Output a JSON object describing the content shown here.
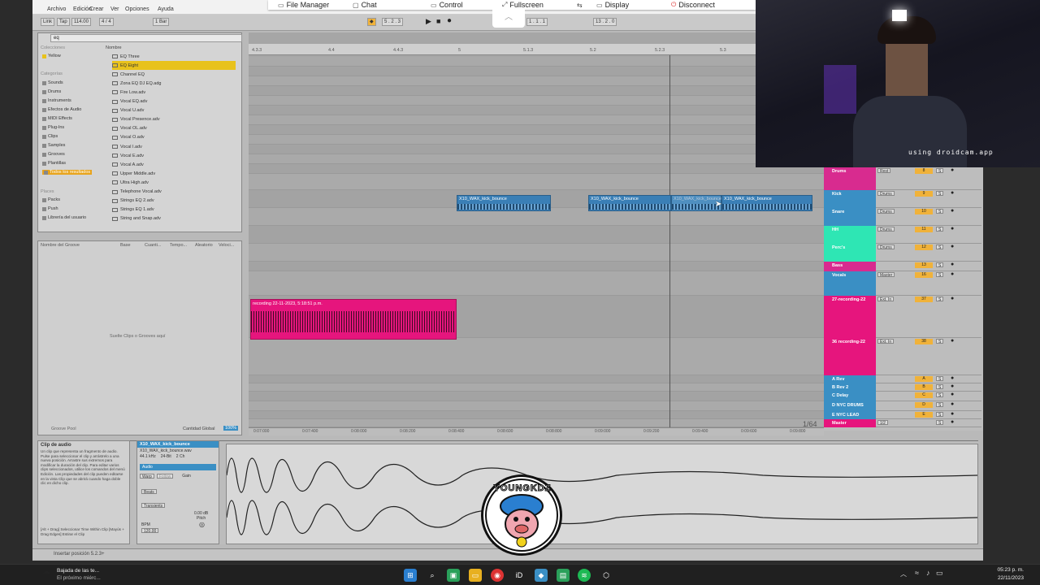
{
  "menu": {
    "items": [
      "Archivo",
      "Edición",
      "Crear",
      "Ver",
      "Opciones",
      "Ayuda"
    ]
  },
  "remote_toolbar": {
    "file_manager": "File Manager",
    "chat": "Chat",
    "control": "Control",
    "fullscreen": "Fullscreen",
    "display": "Display",
    "disconnect": "Disconnect"
  },
  "transport": {
    "link": "Link",
    "tap": "Tap",
    "tempo": "114.00",
    "meter": "4 / 4",
    "bar": "1 Bar",
    "position": "5 . 2 . 3",
    "loop_start": "1 . 1 . 1",
    "loop_len": "13 . 2 . 0"
  },
  "browser": {
    "search_value": "eq",
    "colors_header": "Colecciones",
    "color_item": "Yellow",
    "categories_header": "Categorías",
    "categories": [
      "Sounds",
      "Drums",
      "Instruments",
      "Efectos de Audio",
      "MIDI Effects",
      "Plug-Ins",
      "Clips",
      "Samples",
      "Grooves",
      "Plantillas",
      "Todos los resultados"
    ],
    "places_header": "Places",
    "places": [
      "Packs",
      "Push",
      "Librería del usuario"
    ],
    "name_header": "Nombre",
    "files": [
      "EQ Three",
      "EQ Eight",
      "Channel EQ",
      "Zona EQ DJ EQ.adg",
      "Fire Low.adv",
      "Vocal EQ.adv",
      "Vocal U.adv",
      "Vocal Presence.adv",
      "Vocal OL.adv",
      "Vocal O.adv",
      "Vocal I.adv",
      "Vocal E.adv",
      "Vocal A.adv",
      "Upper Middle.adv",
      "Ultra High.adv",
      "Telephone Vocal.adv",
      "Strings EQ 2.adv",
      "Strings EQ 1.adv",
      "String and Snap.adv"
    ]
  },
  "groove_pool": {
    "headers": [
      "Nombre del Groove",
      "Base",
      "Cuanti...",
      "Tempo...",
      "Aleatorio",
      "Veloci..."
    ],
    "empty": "Suelte Clips o Grooves aquí",
    "footer": "Groove Pool",
    "global_label": "Cantidad Global",
    "global_value": "100%"
  },
  "arrangement": {
    "ruler": [
      "4.3.3",
      "4.4",
      "4.4.3",
      "5",
      "5.1.3",
      "5.2",
      "5.2.3",
      "5.3"
    ],
    "time_ruler": [
      "0:07:000",
      "0:07:400",
      "0:08:000",
      "0:08:200",
      "0:08:400",
      "0:08:600",
      "0:08:800",
      "0:09:000",
      "0:09:200",
      "0:09:400",
      "0:09:600",
      "0:09:800"
    ],
    "clips": [
      "X10_WAX_kick_bounce",
      "X10_WAX_kick_bounce",
      "X10_WAX_kick_bounce",
      "X10_WAX_kick_bounce"
    ],
    "recording_clip": "recording 22-11-2023, 5:18:51 p.m.",
    "zoom": "1/64"
  },
  "tracks": [
    {
      "name": "Drums",
      "color": "#d82b8f",
      "route": "Rest",
      "num": "8"
    },
    {
      "name": "Kick",
      "color": "#3a8fc4",
      "route": "Drums",
      "num": "9"
    },
    {
      "name": "Snare",
      "color": "#3a8fc4",
      "route": "Drums",
      "num": "10"
    },
    {
      "name": "HH",
      "color": "#2ee6b4",
      "route": "Drums",
      "num": "11"
    },
    {
      "name": "Perc's",
      "color": "#2ee6b4",
      "route": "Drums",
      "num": "12"
    },
    {
      "name": "Bass",
      "color": "#d82b8f",
      "route": "",
      "num": "13"
    },
    {
      "name": "Vocals",
      "color": "#3a8fc4",
      "route": "Master",
      "num": "16"
    },
    {
      "name": "27-recording-22",
      "color": "#e6157d",
      "route": "Ext. In",
      "num": "37"
    },
    {
      "name": "36 recording-22",
      "color": "#e6157d",
      "route": "Ext. In",
      "num": "38"
    },
    {
      "name": "A Rev",
      "color": "#3a8fc4",
      "route": "",
      "num": "A"
    },
    {
      "name": "B Rev 2",
      "color": "#3a8fc4",
      "route": "",
      "num": "B"
    },
    {
      "name": "C Delay",
      "color": "#3a8fc4",
      "route": "",
      "num": "C"
    },
    {
      "name": "D NYC DRUMS",
      "color": "#3a8fc4",
      "route": "",
      "num": "D"
    },
    {
      "name": "E NYC LEAD",
      "color": "#3a8fc4",
      "route": "",
      "num": "E"
    },
    {
      "name": "Master",
      "color": "#e6157d",
      "route": "1/2",
      "num": ""
    }
  ],
  "detail": {
    "info_title": "Clip de audio",
    "info_text": "Un clip que representa un fragmento de audio. Pulse para seleccionar el clip y arrástrelo a una nueva posición. Arrastre sus extremos para modificar la duración del clip. Para editar varios clips seleccionados, utilice los comandos del menú Edición. Las propiedades del clip pueden editarse en la vista Clip que se abrirá cuando haga doble clic en dicho clip.",
    "info_shortcut": "[Alt + Drag] Seleccionar Time Within Clip [Mayús + Drag Edges] Estirar el Clip",
    "clip_name": "X10_WAX_kick_bounce",
    "file_name": "X10_WAX_kick_bounce.wav",
    "sample_rate": "44.1 kHz",
    "bit_depth": "24-Bit",
    "channels": "2 Ch",
    "audio_label": "Audio",
    "warp": "Warp",
    "follow": "Follow",
    "gain_label": "Gain",
    "gain_value": "0.00 dB",
    "pitch_label": "Pitch",
    "mode": "Beats",
    "preserve": "Transients",
    "bpm_label": "BPM",
    "bpm_value": "120.00"
  },
  "status": {
    "text": "Insertar posición 5.2.3+"
  },
  "webcam": {
    "overlay": "using droidcam.app"
  },
  "logo": {
    "text": "YOUNGKDZ"
  },
  "taskbar": {
    "notification_title": "Bajada de las te...",
    "notification_sub": "El próximo miérc...",
    "time": "05:23 p. m.",
    "date": "22/11/2023"
  }
}
